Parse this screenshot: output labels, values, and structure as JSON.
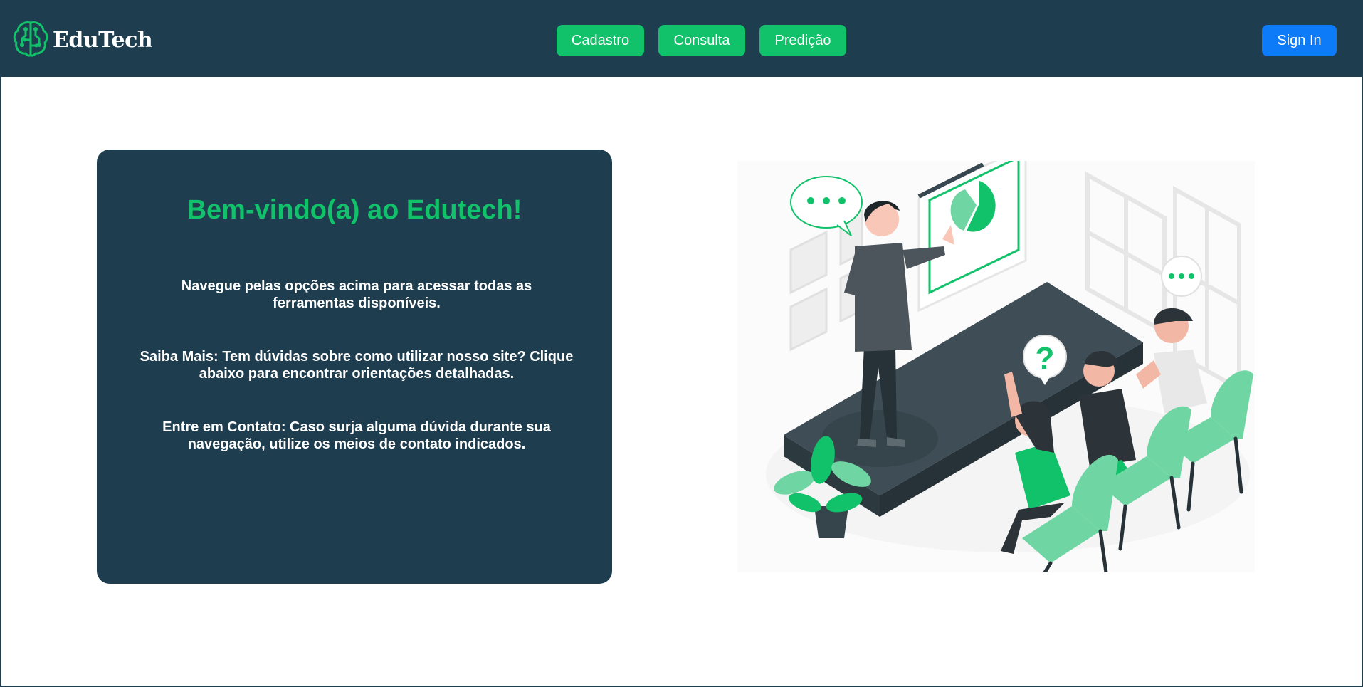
{
  "navbar": {
    "brand": "EduTech",
    "logo_icon": "brain-chip-icon",
    "links": [
      {
        "label": "Cadastro"
      },
      {
        "label": "Consulta"
      },
      {
        "label": "Predição"
      }
    ],
    "signin_label": "Sign In"
  },
  "welcome": {
    "title": "Bem-vindo(a) ao Edutech!",
    "paragraphs": [
      "Navegue pelas opções acima para acessar todas as ferramentas disponíveis.",
      "Saiba Mais: Tem dúvidas sobre como utilizar nosso site? Clique abaixo para encontrar orientações detalhadas.",
      "Entre em Contato: Caso surja alguma dúvida durante sua navegação, utilize os meios de contato indicados."
    ]
  },
  "illustration": {
    "icon": "classroom-presentation-illustration",
    "question_mark": "?"
  },
  "colors": {
    "navbar": "#1e3d4f",
    "accent": "#12c26a",
    "primary": "#0d7bf7",
    "card": "#1e3d4f"
  }
}
